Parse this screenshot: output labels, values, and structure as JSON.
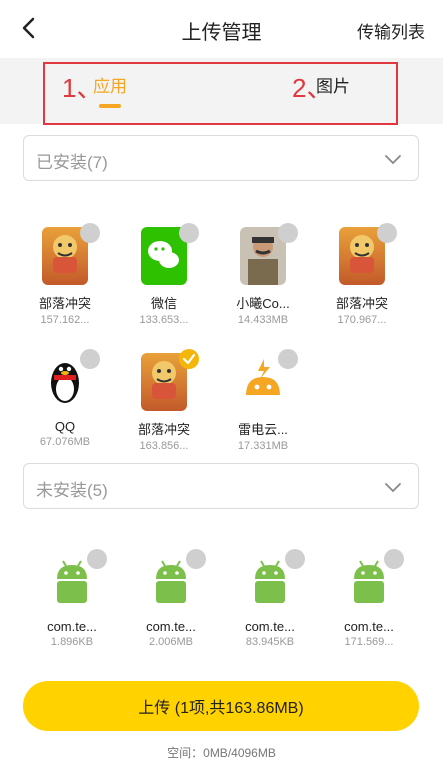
{
  "header": {
    "title": "上传管理",
    "transfer_list": "传输列表"
  },
  "tabs": [
    {
      "label": "应用",
      "active": true
    },
    {
      "label": "图片",
      "active": false
    }
  ],
  "annotations": {
    "n1": "1、",
    "n2": "2、"
  },
  "installed": {
    "label": "已安装(7)",
    "apps": [
      {
        "name": "部落冲突",
        "size": "157.162...",
        "icon": "clash-of-clans-icon",
        "checked": false
      },
      {
        "name": "微信",
        "size": "133.653...",
        "icon": "wechat-icon",
        "checked": false
      },
      {
        "name": "小曦Co...",
        "size": "14.433MB",
        "icon": "stalin-icon",
        "checked": false
      },
      {
        "name": "部落冲突",
        "size": "170.967...",
        "icon": "clash-of-clans-icon",
        "checked": false
      },
      {
        "name": "QQ",
        "size": "67.076MB",
        "icon": "qq-penguin-icon",
        "checked": false
      },
      {
        "name": "部落冲突",
        "size": "163.856...",
        "icon": "clash-of-clans-icon",
        "checked": true
      },
      {
        "name": "雷电云...",
        "size": "17.331MB",
        "icon": "ldcloud-icon",
        "checked": false
      }
    ]
  },
  "not_installed": {
    "label": "未安装(5)",
    "apps": [
      {
        "name": "com.te...",
        "size": "1.896KB",
        "icon": "android-icon",
        "checked": false
      },
      {
        "name": "com.te...",
        "size": "2.006MB",
        "icon": "android-icon",
        "checked": false
      },
      {
        "name": "com.te...",
        "size": "83.945KB",
        "icon": "android-icon",
        "checked": false
      },
      {
        "name": "com.te...",
        "size": "171.569...",
        "icon": "android-icon",
        "checked": false
      }
    ]
  },
  "upload_button": "上传 (1项,共163.86MB)",
  "space": "空间：0MB/4096MB",
  "colors": {
    "accent": "#f5a623",
    "button": "#ffd200",
    "annotation": "#e0383e"
  }
}
